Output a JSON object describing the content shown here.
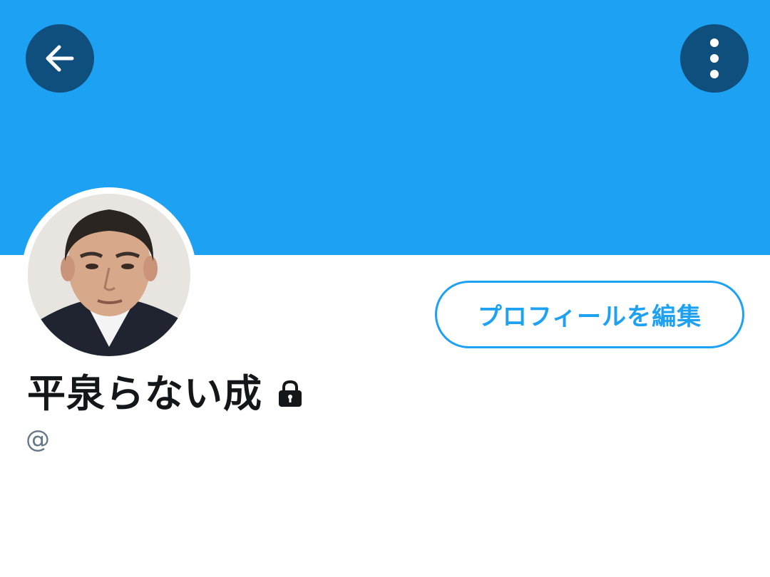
{
  "header": {
    "back_icon": "arrow-left-icon",
    "more_icon": "more-vertical-icon",
    "banner_color": "#1DA1F2",
    "button_color": "#0F4F7D"
  },
  "profile": {
    "display_name": "平泉らない成",
    "protected_icon": "lock-icon",
    "handle": "@",
    "edit_button_label": "プロフィールを編集"
  },
  "colors": {
    "accent": "#1DA1F2",
    "text_primary": "#14171A",
    "text_secondary": "#657786"
  }
}
